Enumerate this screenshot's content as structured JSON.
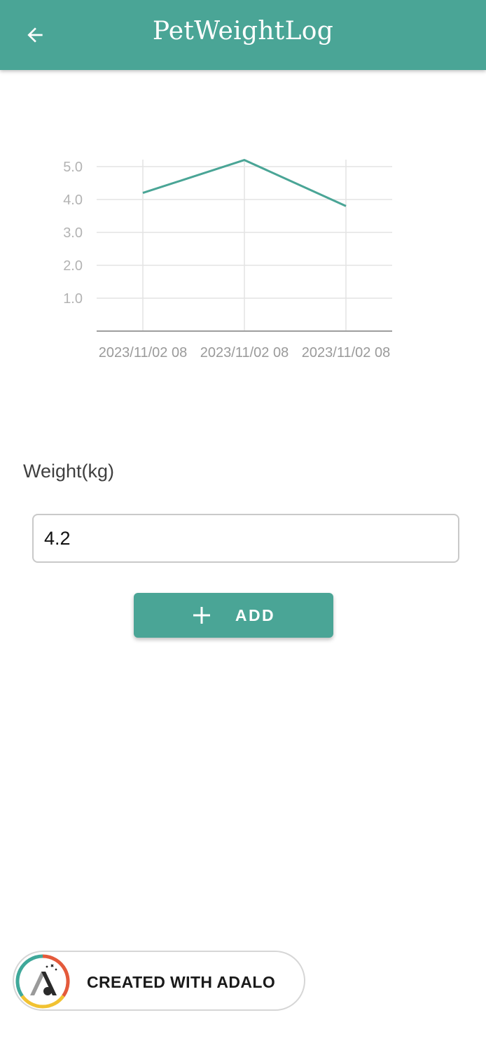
{
  "header": {
    "title": "PetWeightLog",
    "back_icon": "arrow-left-icon",
    "background_color": "#4aa596"
  },
  "chart_data": {
    "type": "line",
    "title": "",
    "xlabel": "",
    "ylabel": "",
    "x": [
      "2023/11/02 08",
      "2023/11/02 08",
      "2023/11/02 08"
    ],
    "series": [
      {
        "values": [
          4.2,
          5.2,
          3.8
        ],
        "color": "#4aa596"
      }
    ],
    "yticks": [
      "1.0",
      "2.0",
      "3.0",
      "4.0",
      "5.0"
    ],
    "ylim": [
      0,
      5.2
    ],
    "grid": true
  },
  "form": {
    "weight_label": "Weight(kg)",
    "weight_value": "4.2",
    "add_button_label": "ADD",
    "add_icon": "plus-icon"
  },
  "badge": {
    "text": "CREATED WITH ADALO",
    "logo_icon": "adalo-logo-icon"
  }
}
